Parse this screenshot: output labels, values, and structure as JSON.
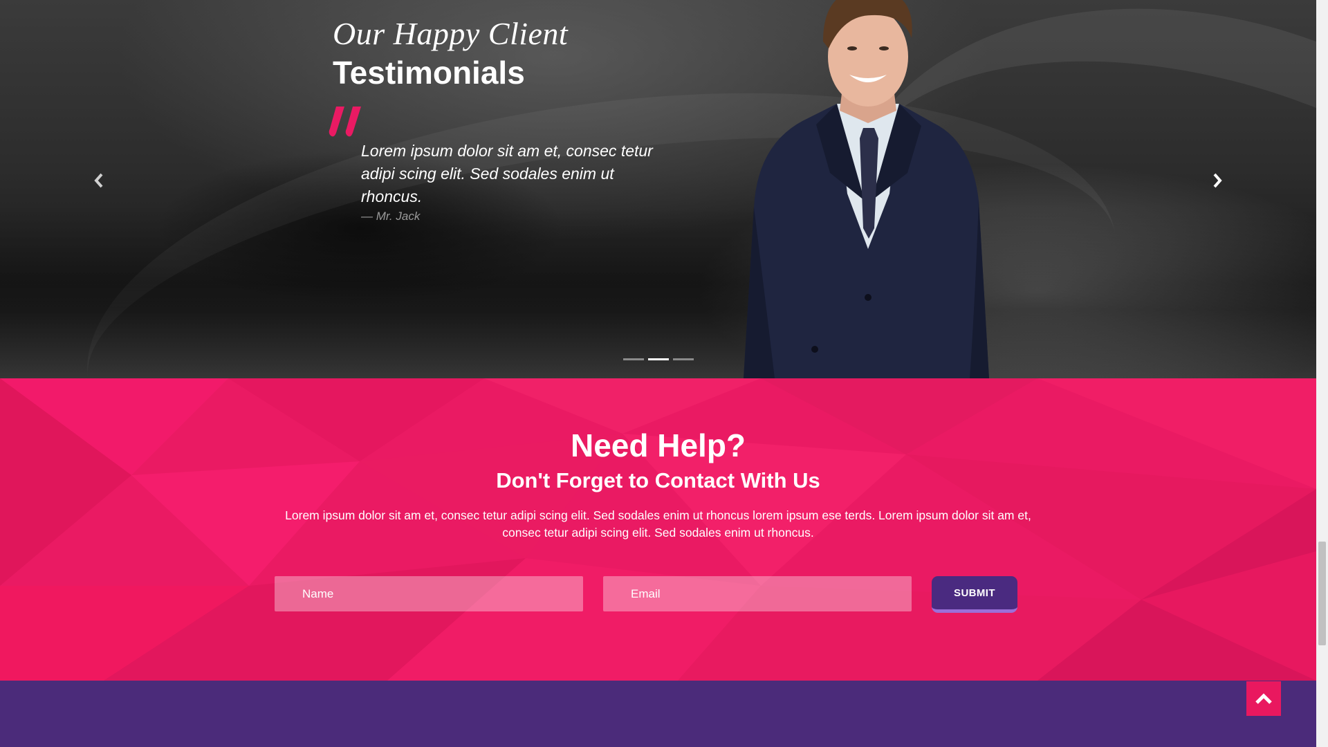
{
  "testimonials": {
    "eyebrow": "Our Happy Client",
    "heading": "Testimonials",
    "quote": "Lorem ipsum dolor sit am et, consec tetur adipi scing elit. Sed sodales enim ut rhoncus.",
    "author": "— Mr. Jack",
    "slides_total": 3,
    "active_slide": 2,
    "prev_icon": "chevron-left-icon",
    "next_icon": "chevron-right-icon",
    "quote_icon": "quote-mark-icon"
  },
  "contact": {
    "title": "Need Help?",
    "subtitle": "Don't Forget to Contact With Us",
    "text": "Lorem ipsum dolor sit am et, consec tetur adipi scing elit. Sed sodales enim ut rhoncus lorem ipsum ese terds. Lorem ipsum dolor sit am et, consec tetur adipi scing elit. Sed sodales enim ut rhoncus.",
    "name_placeholder": "Name",
    "email_placeholder": "Email",
    "submit_label": "SUBMIT"
  },
  "scroll_to_top_icon": "chevron-up-icon",
  "colors": {
    "accent_pink": "#ea1a63",
    "purple": "#4b2b7a",
    "submit_purple": "#4a2a80",
    "submit_underline": "#9b6fd9"
  }
}
